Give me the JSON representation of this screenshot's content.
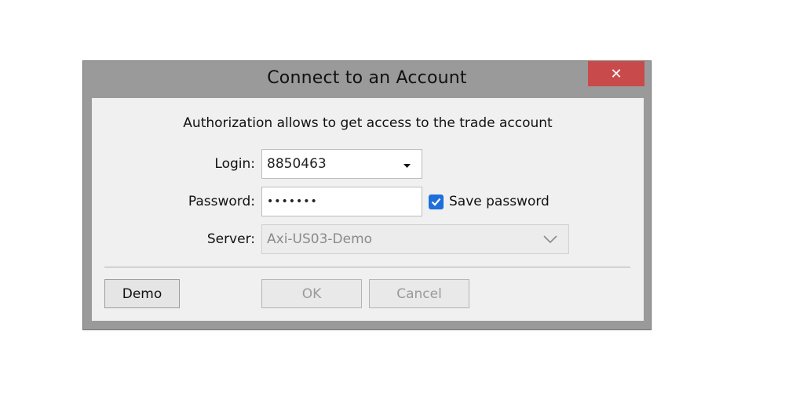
{
  "window": {
    "title": "Connect to an Account",
    "close_glyph": "✕"
  },
  "subtitle": "Authorization allows to get access to the trade account",
  "form": {
    "login_label": "Login:",
    "login_value": "8850463",
    "password_label": "Password:",
    "password_value": "•••••••",
    "save_password_label": "Save password",
    "save_password_checked": true,
    "server_label": "Server:",
    "server_value": "Axi-US03-Demo"
  },
  "buttons": {
    "demo": "Demo",
    "ok": "OK",
    "cancel": "Cancel"
  },
  "colors": {
    "close_bg": "#c94a4a",
    "checkbox_accent": "#1e6fd9"
  },
  "icons": {
    "close": "close-icon",
    "login_dropdown": "caret-down-icon",
    "server_dropdown": "chevron-down-icon",
    "checkbox": "checkmark-icon"
  }
}
